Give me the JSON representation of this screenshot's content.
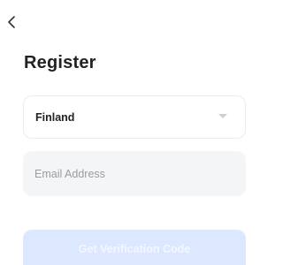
{
  "header": {
    "back_icon": "chevron-left-icon",
    "title": "Register"
  },
  "form": {
    "country": {
      "selected": "Finland",
      "icon": "caret-down-icon"
    },
    "email": {
      "value": "",
      "placeholder": "Email Address"
    },
    "submit": {
      "label": "Get Verification Code",
      "state": "disabled"
    }
  },
  "colors": {
    "field_background": "#f4f5f7",
    "button_disabled_background": "#dce8ff",
    "button_disabled_text": "#f4f7ff",
    "title_text": "#222222"
  }
}
